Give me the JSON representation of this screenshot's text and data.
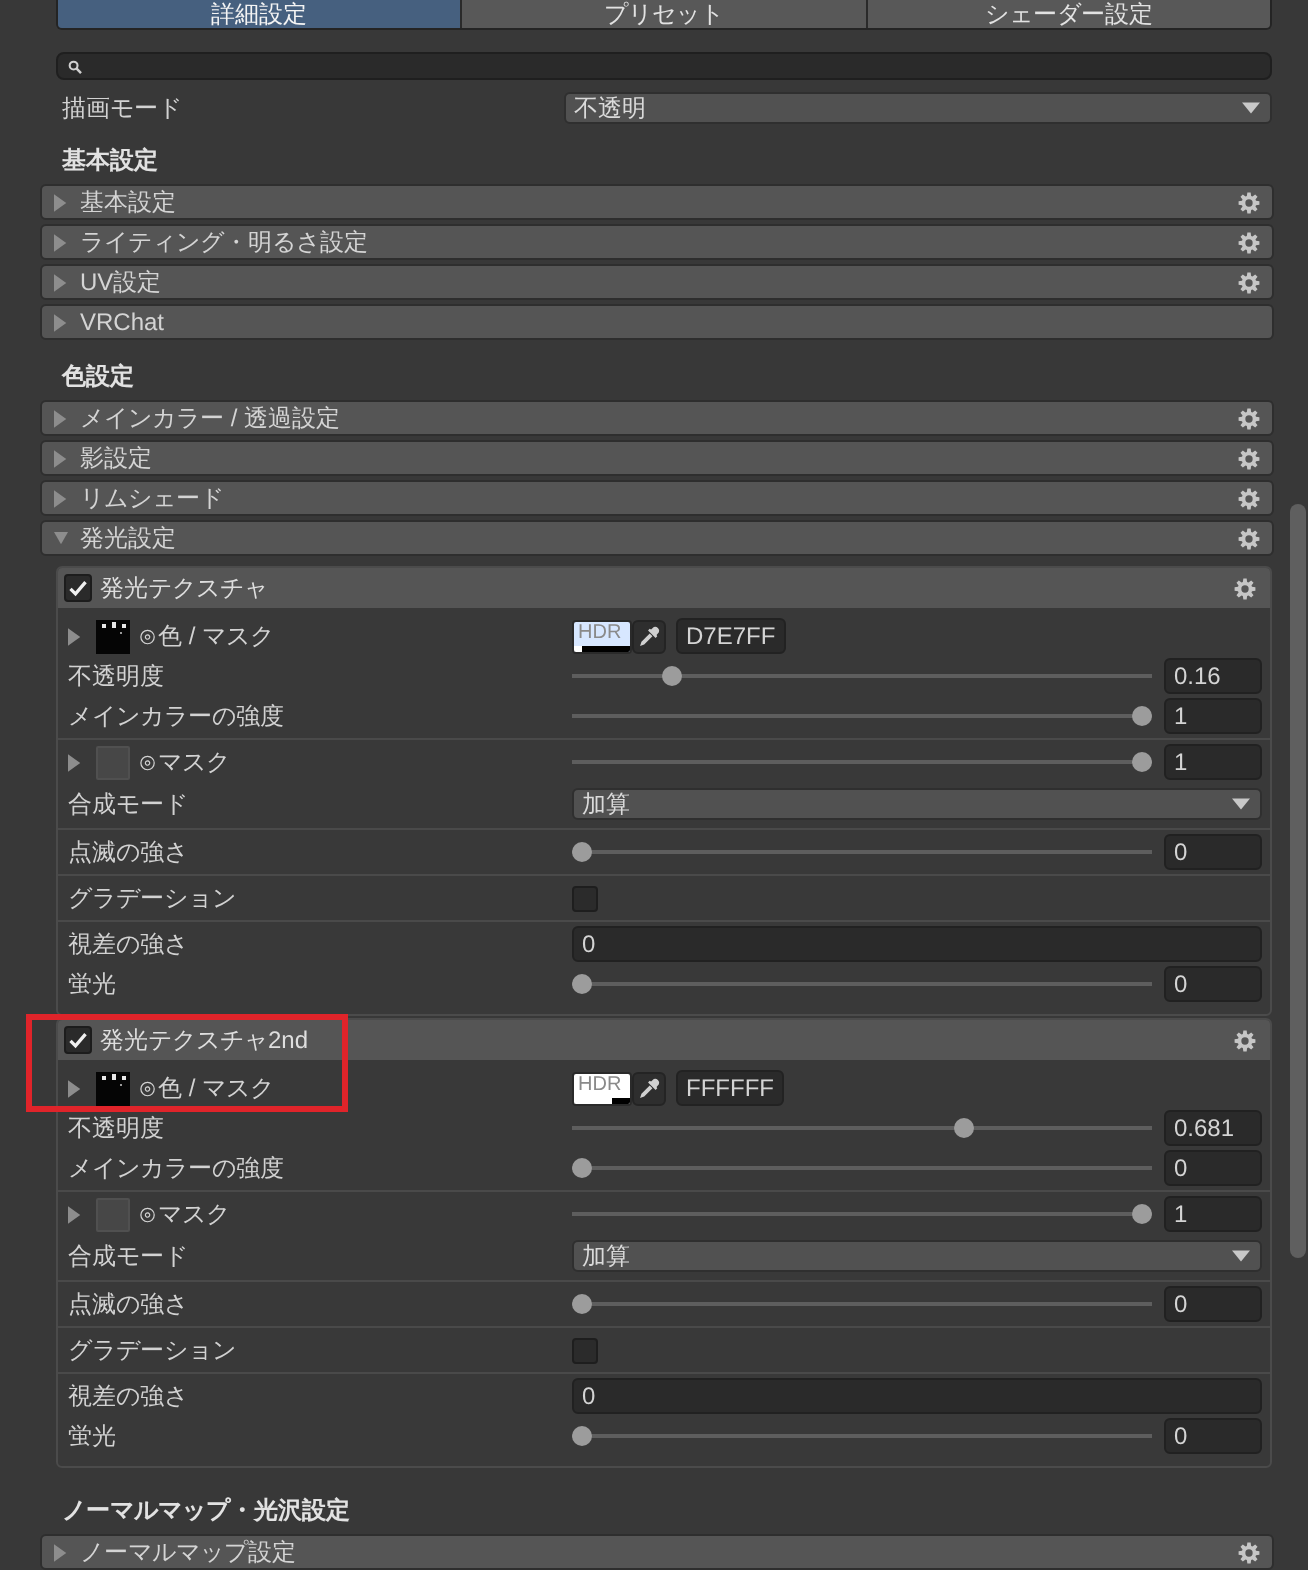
{
  "tabs": [
    {
      "label": "詳細設定",
      "selected": true
    },
    {
      "label": "プリセット",
      "selected": false
    },
    {
      "label": "シェーダー設定",
      "selected": false
    }
  ],
  "render_mode": {
    "label": "描画モード",
    "value": "不透明"
  },
  "sections": [
    {
      "title": "基本設定",
      "groups": [
        {
          "label": "基本設定",
          "expanded": false,
          "settings_icon": true
        },
        {
          "label": "ライティング・明るさ設定",
          "expanded": false,
          "settings_icon": true
        },
        {
          "label": "UV設定",
          "expanded": false,
          "settings_icon": true
        },
        {
          "label": "VRChat",
          "expanded": false,
          "settings_icon": false
        }
      ]
    },
    {
      "title": "色設定",
      "groups": [
        {
          "label": "メインカラー / 透過設定",
          "expanded": false,
          "settings_icon": true
        },
        {
          "label": "影設定",
          "expanded": false,
          "settings_icon": true
        },
        {
          "label": "リムシェード",
          "expanded": false,
          "settings_icon": true
        },
        {
          "label": "発光設定",
          "expanded": true,
          "settings_icon": true,
          "panels": [
            {
              "title": "発光テクスチャ",
              "checked": true,
              "settings_icon": true,
              "highlighted": false,
              "row_groups": [
                [
                  {
                    "kind": "texture",
                    "expanded": false,
                    "label": "⊙色 / マスク",
                    "color": "#d7e7ff",
                    "level": 0.16,
                    "badge": "HDR",
                    "hex": "D7E7FF"
                  },
                  {
                    "kind": "slider",
                    "label": "不透明度",
                    "level": 0.16,
                    "value": "0.16"
                  },
                  {
                    "kind": "slider",
                    "label": "メインカラーの強度",
                    "level": 1,
                    "value": "1"
                  }
                ],
                [
                  {
                    "kind": "mask",
                    "expanded": false,
                    "label": "⊙マスク",
                    "level": 1,
                    "value": "1"
                  },
                  {
                    "kind": "dropdown",
                    "label": "合成モード",
                    "value": "加算"
                  }
                ],
                [
                  {
                    "kind": "slider",
                    "label": "点滅の強さ",
                    "level": 0,
                    "value": "0"
                  }
                ],
                [
                  {
                    "kind": "checkbox",
                    "label": "グラデーション",
                    "checked": false
                  }
                ],
                [
                  {
                    "kind": "number",
                    "label": "視差の強さ",
                    "value": "0"
                  },
                  {
                    "kind": "slider",
                    "label": "蛍光",
                    "level": 0,
                    "value": "0"
                  }
                ]
              ]
            },
            {
              "title": "発光テクスチャ2nd",
              "checked": true,
              "settings_icon": true,
              "highlighted": true,
              "row_groups": [
                [
                  {
                    "kind": "texture",
                    "expanded": false,
                    "label": "⊙色 / マスク",
                    "color": "#ffffff",
                    "level": 0.681,
                    "badge": "HDR",
                    "hex": "FFFFFF"
                  },
                  {
                    "kind": "slider",
                    "label": "不透明度",
                    "level": 0.681,
                    "value": "0.681"
                  },
                  {
                    "kind": "slider",
                    "label": "メインカラーの強度",
                    "level": 0,
                    "value": "0"
                  }
                ],
                [
                  {
                    "kind": "mask",
                    "expanded": false,
                    "label": "⊙マスク",
                    "level": 1,
                    "value": "1"
                  },
                  {
                    "kind": "dropdown",
                    "label": "合成モード",
                    "value": "加算"
                  }
                ],
                [
                  {
                    "kind": "slider",
                    "label": "点滅の強さ",
                    "level": 0,
                    "value": "0"
                  }
                ],
                [
                  {
                    "kind": "checkbox",
                    "label": "グラデーション",
                    "checked": false
                  }
                ],
                [
                  {
                    "kind": "number",
                    "label": "視差の強さ",
                    "value": "0"
                  },
                  {
                    "kind": "slider",
                    "label": "蛍光",
                    "level": 0,
                    "value": "0"
                  }
                ]
              ]
            }
          ]
        }
      ]
    },
    {
      "title": "ノーマルマップ・光沢設定",
      "groups": [
        {
          "label": "ノーマルマップ設定",
          "expanded": false,
          "settings_icon": true
        }
      ]
    }
  ]
}
